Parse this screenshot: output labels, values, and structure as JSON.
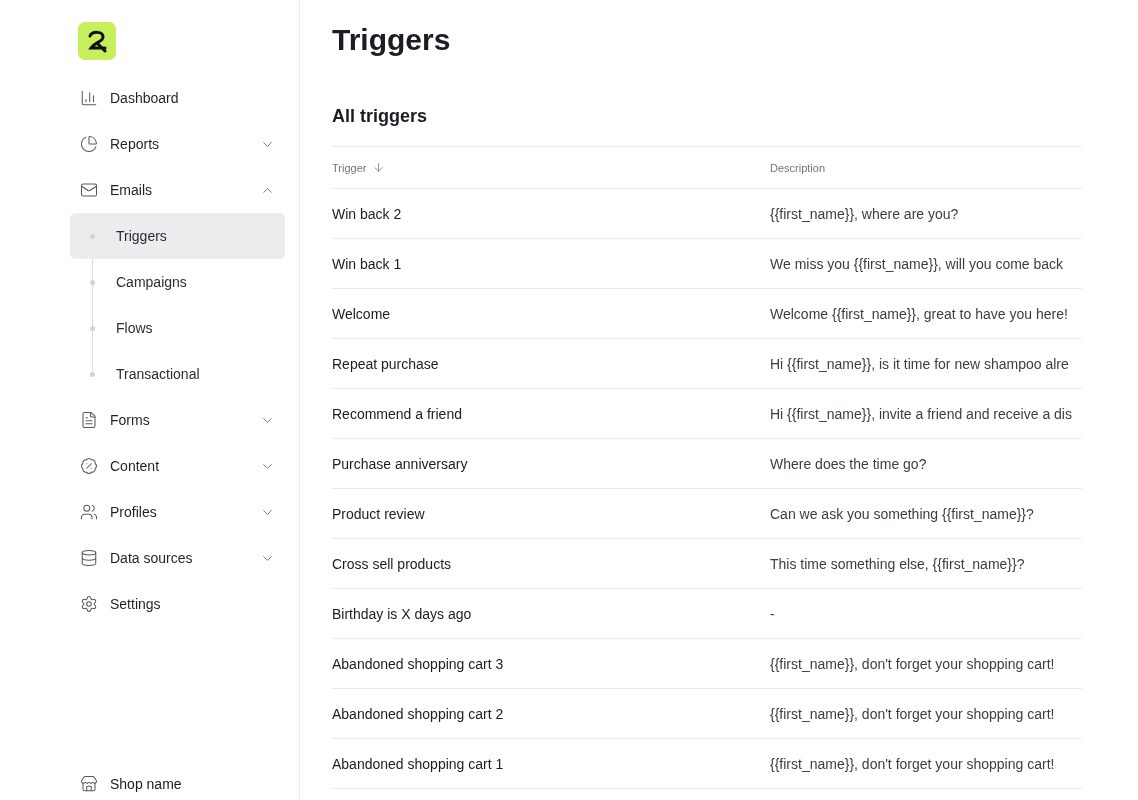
{
  "sidebar": {
    "items": [
      {
        "label": "Dashboard"
      },
      {
        "label": "Reports",
        "expanded": false
      },
      {
        "label": "Emails",
        "expanded": true,
        "children": [
          {
            "label": "Triggers",
            "selected": true
          },
          {
            "label": "Campaigns",
            "selected": false
          },
          {
            "label": "Flows",
            "selected": false
          },
          {
            "label": "Transactional",
            "selected": false
          }
        ]
      },
      {
        "label": "Forms",
        "expanded": false
      },
      {
        "label": "Content",
        "expanded": false
      },
      {
        "label": "Profiles",
        "expanded": false
      },
      {
        "label": "Data sources",
        "expanded": false
      },
      {
        "label": "Settings"
      }
    ],
    "footer": {
      "label": "Shop name"
    }
  },
  "page": {
    "title": "Triggers",
    "section_title": "All triggers"
  },
  "table": {
    "columns": [
      "Trigger",
      "Description"
    ],
    "rows": [
      [
        "Win back 2",
        "{{first_name}}, where are you?"
      ],
      [
        "Win back 1",
        "We miss you {{first_name}}, will you come back"
      ],
      [
        "Welcome",
        "Welcome {{first_name}}, great to have you here!"
      ],
      [
        "Repeat purchase",
        "Hi {{first_name}}, is it time for new shampoo alre"
      ],
      [
        "Recommend a friend",
        "Hi {{first_name}}, invite a friend and receive a dis"
      ],
      [
        "Purchase anniversary",
        "Where does the time go?"
      ],
      [
        "Product review",
        "Can we ask you something {{first_name}}?"
      ],
      [
        "Cross sell products",
        "This time something else, {{first_name}}?"
      ],
      [
        "Birthday is X days ago",
        "-"
      ],
      [
        "Abandoned shopping cart 3",
        "{{first_name}}, don't forget your shopping cart!"
      ],
      [
        "Abandoned shopping cart 2",
        "{{first_name}}, don't forget your shopping cart!"
      ],
      [
        "Abandoned shopping cart 1",
        "{{first_name}}, don't forget your shopping cart!"
      ]
    ]
  }
}
